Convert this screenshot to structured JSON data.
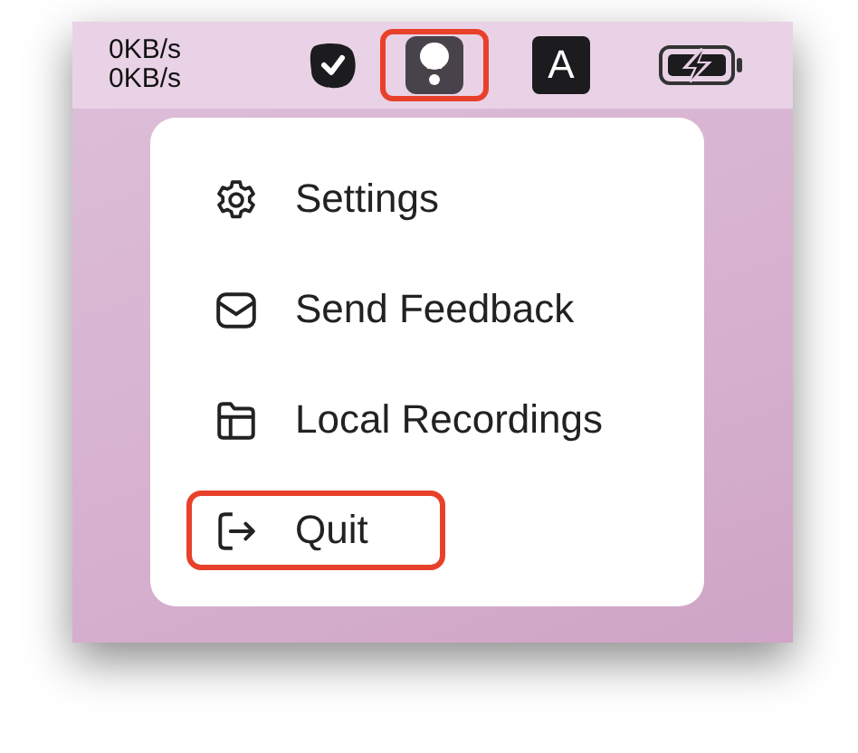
{
  "menu_bar": {
    "network_speed": [
      "0KB/s",
      "0KB/s"
    ],
    "icons": [
      {
        "kind": "check",
        "highlighted": false
      },
      {
        "kind": "app",
        "highlighted": true
      },
      {
        "kind": "letter",
        "label": "A",
        "highlighted": false
      },
      {
        "kind": "battery",
        "highlighted": false
      }
    ]
  },
  "menu": {
    "items": [
      {
        "kind": "settings",
        "label": "Settings",
        "highlighted": false
      },
      {
        "kind": "feedback",
        "label": "Send Feedback",
        "highlighted": false
      },
      {
        "kind": "recordings",
        "label": "Local Recordings",
        "highlighted": false
      },
      {
        "kind": "quit",
        "label": "Quit",
        "highlighted": true
      }
    ]
  }
}
